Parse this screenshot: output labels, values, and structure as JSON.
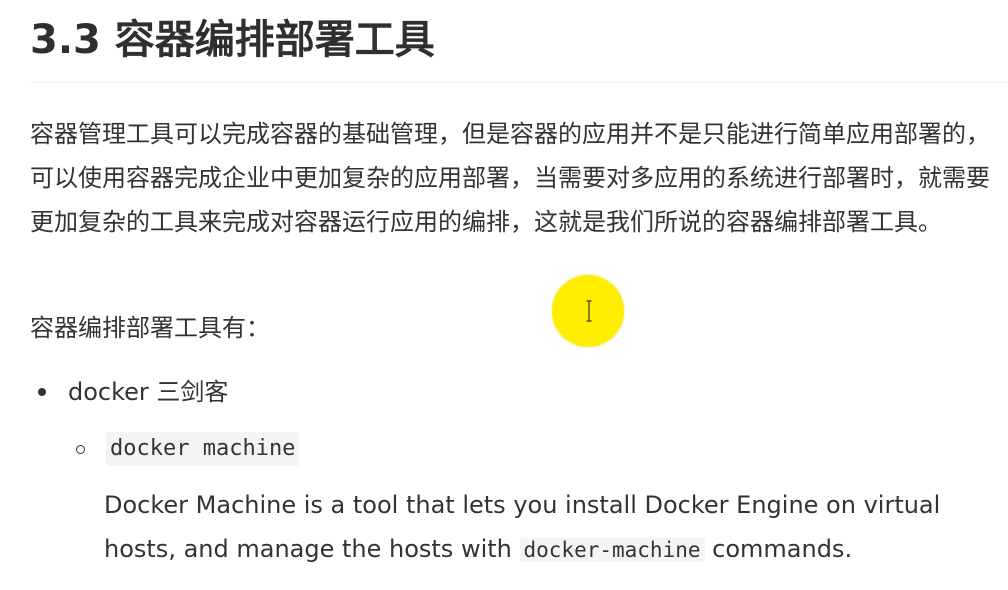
{
  "heading": "3.3 容器编排部署工具",
  "intro_paragraph": "容器管理工具可以完成容器的基础管理，但是容器的应用并不是只能进行简单应用部署的，可以使用容器完成企业中更加复杂的应用部署，当需要对多应用的系统进行部署时，就需要更加复杂的工具来完成对容器运行应用的编排，这就是我们所说的容器编排部署工具。",
  "list_lead": "容器编排部署工具有：",
  "list": {
    "item_1": {
      "label": "docker 三剑客",
      "sub_item_1": {
        "code": "docker machine",
        "desc_before": "Docker Machine is a tool that lets you install Docker Engine on virtual hosts, and manage the hosts with ",
        "desc_code": "docker-machine",
        "desc_after": " commands."
      }
    }
  },
  "colors": {
    "text": "#333333",
    "code_background": "#f3f4f4",
    "cursor_highlight": "#ffee00"
  },
  "icons": {
    "cursor": "text-cursor-icon"
  }
}
